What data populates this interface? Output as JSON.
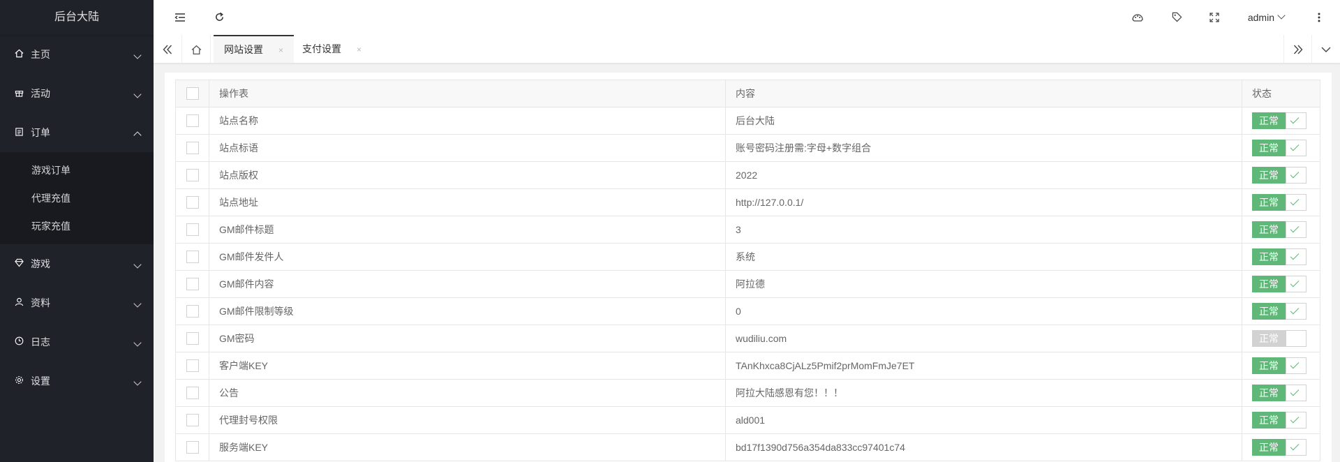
{
  "app": {
    "title": "后台大陆"
  },
  "sidebar": {
    "items": [
      {
        "label": "主页",
        "icon": "home-icon",
        "expanded": false
      },
      {
        "label": "活动",
        "icon": "gift-icon",
        "expanded": false
      },
      {
        "label": "订单",
        "icon": "clipboard-icon",
        "expanded": true,
        "children": [
          "游戏订单",
          "代理充值",
          "玩家充值"
        ]
      },
      {
        "label": "游戏",
        "icon": "diamond-icon",
        "expanded": false
      },
      {
        "label": "资料",
        "icon": "user-icon",
        "expanded": false
      },
      {
        "label": "日志",
        "icon": "clock-icon",
        "expanded": false
      },
      {
        "label": "设置",
        "icon": "gear-icon",
        "expanded": false
      }
    ]
  },
  "header": {
    "user": "admin",
    "icons": [
      "menu-collapse-icon",
      "refresh-icon",
      "theme-icon",
      "tag-icon",
      "fullscreen-icon",
      "more-icon"
    ]
  },
  "tabs": {
    "items": [
      {
        "label": "网站设置",
        "close": "×",
        "active": true
      },
      {
        "label": "支付设置",
        "close": "×",
        "active": false
      }
    ]
  },
  "table": {
    "columns": [
      "操作表",
      "内容",
      "状态"
    ],
    "rows": [
      {
        "name": "站点名称",
        "value": "后台大陆",
        "status": "正常",
        "on": true
      },
      {
        "name": "站点标语",
        "value": "账号密码注册需:字母+数字组合",
        "status": "正常",
        "on": true
      },
      {
        "name": "站点版权",
        "value": "2022",
        "status": "正常",
        "on": true
      },
      {
        "name": "站点地址",
        "value": "http://127.0.0.1/",
        "status": "正常",
        "on": true
      },
      {
        "name": "GM邮件标题",
        "value": "3",
        "status": "正常",
        "on": true
      },
      {
        "name": "GM邮件发件人",
        "value": "系统",
        "status": "正常",
        "on": true
      },
      {
        "name": "GM邮件内容",
        "value": "阿拉德",
        "status": "正常",
        "on": true
      },
      {
        "name": "GM邮件限制等级",
        "value": "0",
        "status": "正常",
        "on": true
      },
      {
        "name": "GM密码",
        "value": "wudiliu.com",
        "status": "正常",
        "on": false
      },
      {
        "name": "客户端KEY",
        "value": "TAnKhxca8CjALz5Pmif2prMomFmJe7ET",
        "status": "正常",
        "on": true
      },
      {
        "name": "公告",
        "value": "阿拉大陆感恩有您！！！",
        "status": "正常",
        "on": true
      },
      {
        "name": "代理封号权限",
        "value": "ald001",
        "status": "正常",
        "on": true
      },
      {
        "name": "服务端KEY",
        "value": "bd17f1390d756a354da833cc97401c74",
        "status": "正常",
        "on": true
      }
    ]
  },
  "colors": {
    "sidebar": "#20222a",
    "switch_on": "#5fb878",
    "switch_off": "#d2d2d2"
  }
}
